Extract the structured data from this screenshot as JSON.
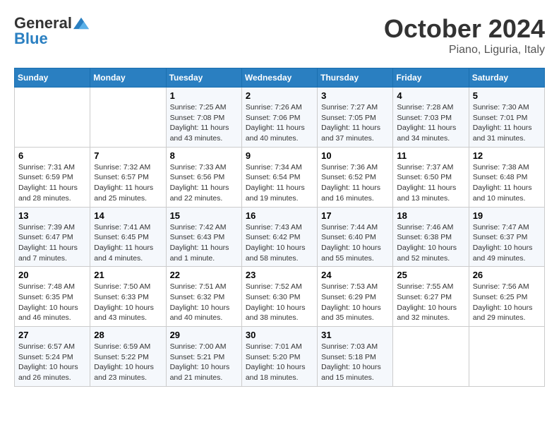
{
  "logo": {
    "general": "General",
    "blue": "Blue"
  },
  "title": "October 2024",
  "subtitle": "Piano, Liguria, Italy",
  "days_header": [
    "Sunday",
    "Monday",
    "Tuesday",
    "Wednesday",
    "Thursday",
    "Friday",
    "Saturday"
  ],
  "weeks": [
    [
      {
        "day": "",
        "info": ""
      },
      {
        "day": "",
        "info": ""
      },
      {
        "day": "1",
        "info": "Sunrise: 7:25 AM\nSunset: 7:08 PM\nDaylight: 11 hours and 43 minutes."
      },
      {
        "day": "2",
        "info": "Sunrise: 7:26 AM\nSunset: 7:06 PM\nDaylight: 11 hours and 40 minutes."
      },
      {
        "day": "3",
        "info": "Sunrise: 7:27 AM\nSunset: 7:05 PM\nDaylight: 11 hours and 37 minutes."
      },
      {
        "day": "4",
        "info": "Sunrise: 7:28 AM\nSunset: 7:03 PM\nDaylight: 11 hours and 34 minutes."
      },
      {
        "day": "5",
        "info": "Sunrise: 7:30 AM\nSunset: 7:01 PM\nDaylight: 11 hours and 31 minutes."
      }
    ],
    [
      {
        "day": "6",
        "info": "Sunrise: 7:31 AM\nSunset: 6:59 PM\nDaylight: 11 hours and 28 minutes."
      },
      {
        "day": "7",
        "info": "Sunrise: 7:32 AM\nSunset: 6:57 PM\nDaylight: 11 hours and 25 minutes."
      },
      {
        "day": "8",
        "info": "Sunrise: 7:33 AM\nSunset: 6:56 PM\nDaylight: 11 hours and 22 minutes."
      },
      {
        "day": "9",
        "info": "Sunrise: 7:34 AM\nSunset: 6:54 PM\nDaylight: 11 hours and 19 minutes."
      },
      {
        "day": "10",
        "info": "Sunrise: 7:36 AM\nSunset: 6:52 PM\nDaylight: 11 hours and 16 minutes."
      },
      {
        "day": "11",
        "info": "Sunrise: 7:37 AM\nSunset: 6:50 PM\nDaylight: 11 hours and 13 minutes."
      },
      {
        "day": "12",
        "info": "Sunrise: 7:38 AM\nSunset: 6:48 PM\nDaylight: 11 hours and 10 minutes."
      }
    ],
    [
      {
        "day": "13",
        "info": "Sunrise: 7:39 AM\nSunset: 6:47 PM\nDaylight: 11 hours and 7 minutes."
      },
      {
        "day": "14",
        "info": "Sunrise: 7:41 AM\nSunset: 6:45 PM\nDaylight: 11 hours and 4 minutes."
      },
      {
        "day": "15",
        "info": "Sunrise: 7:42 AM\nSunset: 6:43 PM\nDaylight: 11 hours and 1 minute."
      },
      {
        "day": "16",
        "info": "Sunrise: 7:43 AM\nSunset: 6:42 PM\nDaylight: 10 hours and 58 minutes."
      },
      {
        "day": "17",
        "info": "Sunrise: 7:44 AM\nSunset: 6:40 PM\nDaylight: 10 hours and 55 minutes."
      },
      {
        "day": "18",
        "info": "Sunrise: 7:46 AM\nSunset: 6:38 PM\nDaylight: 10 hours and 52 minutes."
      },
      {
        "day": "19",
        "info": "Sunrise: 7:47 AM\nSunset: 6:37 PM\nDaylight: 10 hours and 49 minutes."
      }
    ],
    [
      {
        "day": "20",
        "info": "Sunrise: 7:48 AM\nSunset: 6:35 PM\nDaylight: 10 hours and 46 minutes."
      },
      {
        "day": "21",
        "info": "Sunrise: 7:50 AM\nSunset: 6:33 PM\nDaylight: 10 hours and 43 minutes."
      },
      {
        "day": "22",
        "info": "Sunrise: 7:51 AM\nSunset: 6:32 PM\nDaylight: 10 hours and 40 minutes."
      },
      {
        "day": "23",
        "info": "Sunrise: 7:52 AM\nSunset: 6:30 PM\nDaylight: 10 hours and 38 minutes."
      },
      {
        "day": "24",
        "info": "Sunrise: 7:53 AM\nSunset: 6:29 PM\nDaylight: 10 hours and 35 minutes."
      },
      {
        "day": "25",
        "info": "Sunrise: 7:55 AM\nSunset: 6:27 PM\nDaylight: 10 hours and 32 minutes."
      },
      {
        "day": "26",
        "info": "Sunrise: 7:56 AM\nSunset: 6:25 PM\nDaylight: 10 hours and 29 minutes."
      }
    ],
    [
      {
        "day": "27",
        "info": "Sunrise: 6:57 AM\nSunset: 5:24 PM\nDaylight: 10 hours and 26 minutes."
      },
      {
        "day": "28",
        "info": "Sunrise: 6:59 AM\nSunset: 5:22 PM\nDaylight: 10 hours and 23 minutes."
      },
      {
        "day": "29",
        "info": "Sunrise: 7:00 AM\nSunset: 5:21 PM\nDaylight: 10 hours and 21 minutes."
      },
      {
        "day": "30",
        "info": "Sunrise: 7:01 AM\nSunset: 5:20 PM\nDaylight: 10 hours and 18 minutes."
      },
      {
        "day": "31",
        "info": "Sunrise: 7:03 AM\nSunset: 5:18 PM\nDaylight: 10 hours and 15 minutes."
      },
      {
        "day": "",
        "info": ""
      },
      {
        "day": "",
        "info": ""
      }
    ]
  ]
}
